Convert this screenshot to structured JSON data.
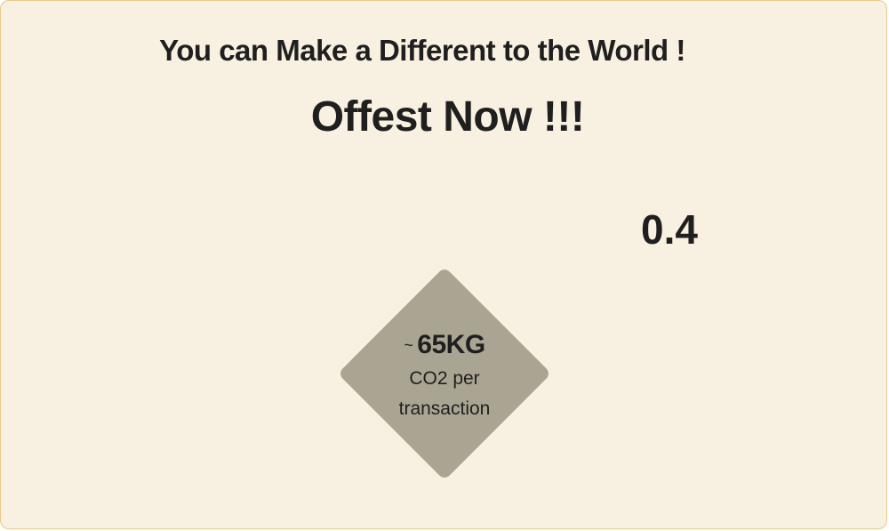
{
  "headline": "You can Make a Different to the World !",
  "cta": "Offest Now !!!",
  "value_display": "0.4",
  "diamond": {
    "prefix": "~",
    "amount": "65KG",
    "line1": "CO2 per",
    "line2": "transaction"
  },
  "colors": {
    "background": "#f8f0e0",
    "border": "#e8c98a",
    "diamond": "#aaa593",
    "text": "#1f1f1f"
  }
}
